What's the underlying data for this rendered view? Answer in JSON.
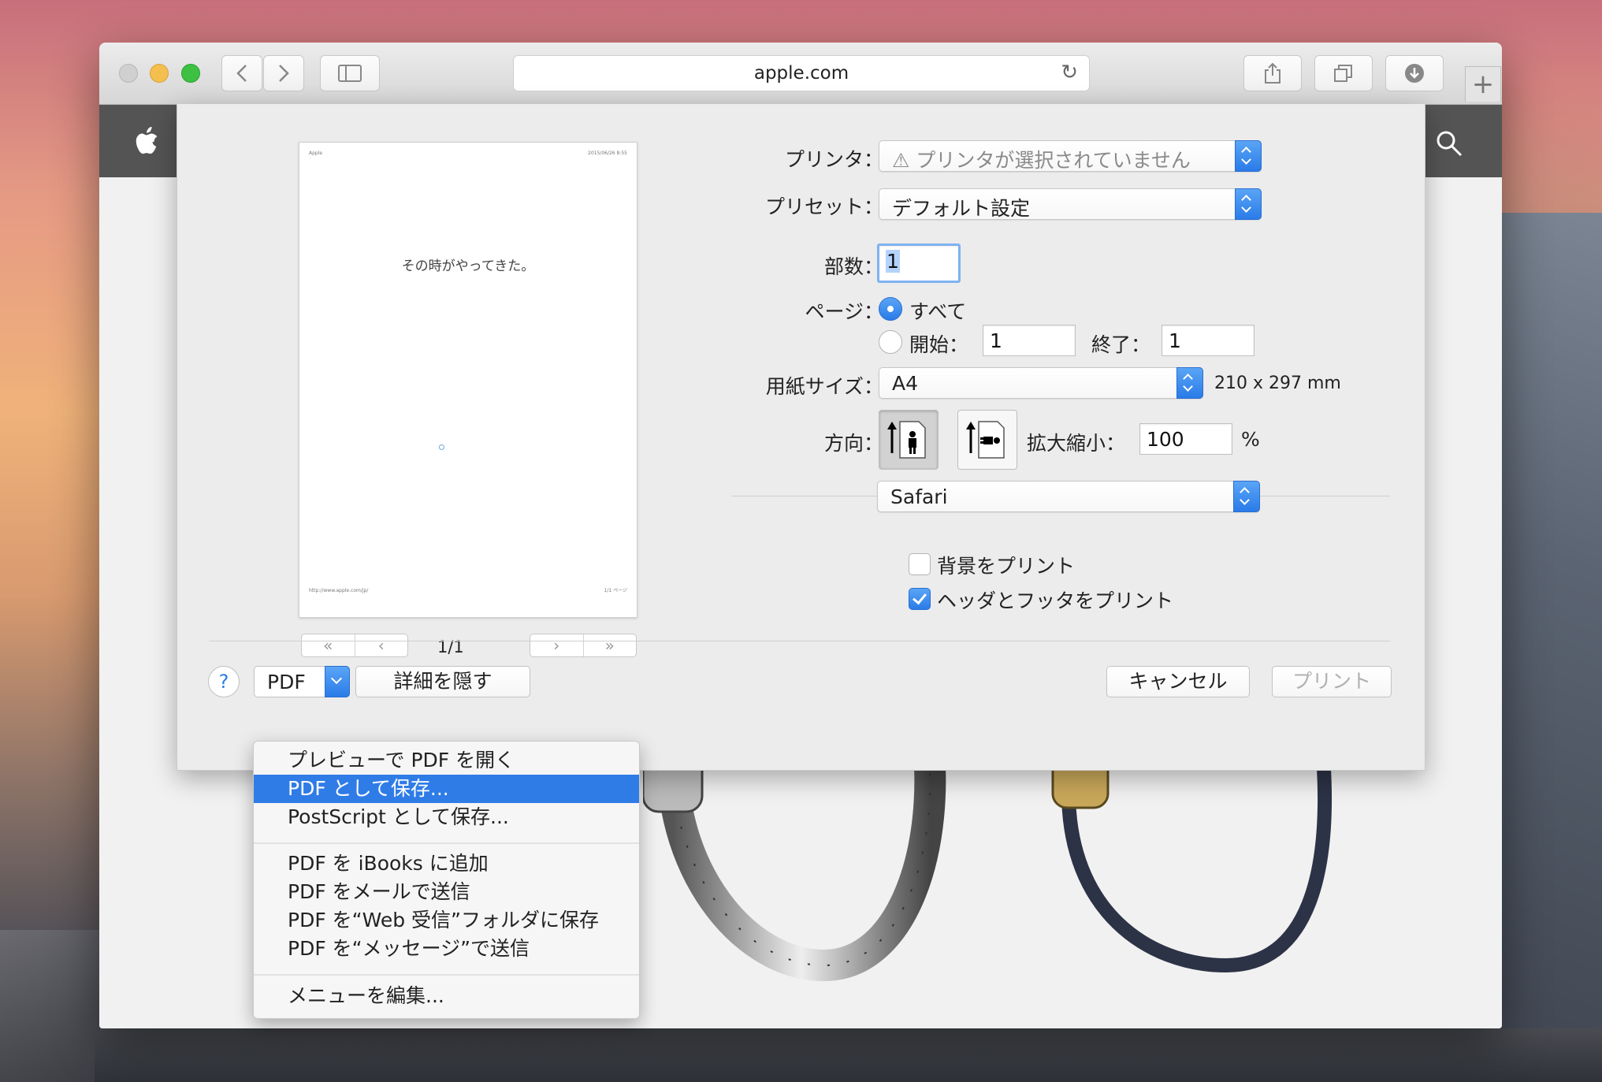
{
  "browser": {
    "url": "apple.com",
    "tab_add": "+"
  },
  "preview": {
    "header_left": "Apple",
    "header_right": "2015/06/26 8:55",
    "headline": "その時がやってきた。",
    "footer_left": "http://www.apple.com/jp/",
    "footer_right": "1/1 ページ",
    "page_indicator": "1/1"
  },
  "print": {
    "printer_label": "プリンタ：",
    "printer_value": "⚠ プリンタが選択されていません",
    "presets_label": "プリセット：",
    "presets_value": "デフォルト設定",
    "copies_label": "部数：",
    "copies_value": "1",
    "pages_label": "ページ：",
    "pages_all": "すべて",
    "pages_from_label": "開始：",
    "pages_from_value": "1",
    "pages_to_label": "終了：",
    "pages_to_value": "1",
    "paper_label": "用紙サイズ：",
    "paper_value": "A4",
    "paper_dims": "210 x 297 mm",
    "orientation_label": "方向：",
    "scale_label": "拡大縮小：",
    "scale_value": "100",
    "scale_unit": "%",
    "section_value": "Safari",
    "print_backgrounds": "背景をプリント",
    "print_headers": "ヘッダとフッタをプリント",
    "help": "?",
    "pdf_label": "PDF",
    "hide_details": "詳細を隠す",
    "cancel": "キャンセル",
    "print": "プリント"
  },
  "pdf_menu": {
    "items": [
      "プレビューで PDF を開く",
      "PDF として保存...",
      "PostScript として保存...",
      "PDF を iBooks に追加",
      "PDF をメールで送信",
      "PDF を“Web 受信”フォルダに保存",
      "PDF を“メッセージ”で送信",
      "メニューを編集..."
    ],
    "highlighted_index": 1
  },
  "colors": {
    "accent": "#2f7ce7",
    "site_nav": "#545454"
  }
}
